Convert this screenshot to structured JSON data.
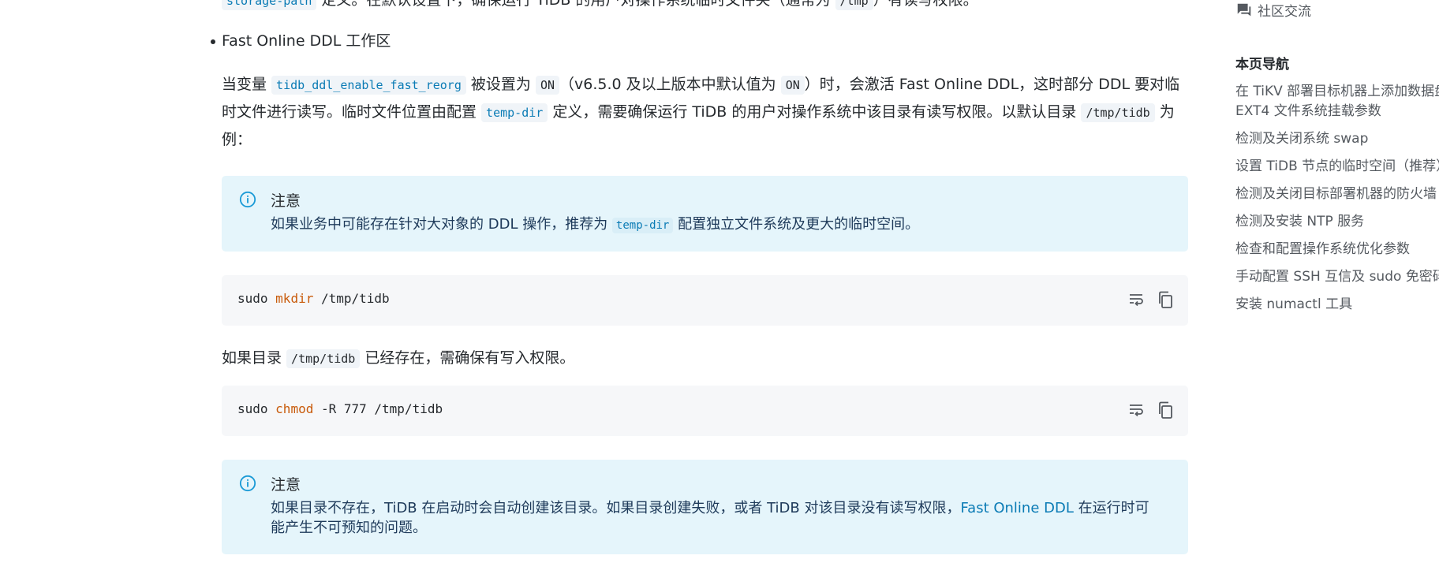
{
  "content": {
    "cut_line": {
      "code1": "storage-path",
      "text": " 定义。在默认设置下，确保运行 TiDB 的用户对操作系统临时文件夹（通常为 ",
      "code2": "/tmp",
      "tail": "）有读写权限。"
    },
    "bullet": "Fast Online DDL 工作区",
    "para": {
      "t1": "当变量 ",
      "c1": "tidb_ddl_enable_fast_reorg",
      "t2": " 被设置为 ",
      "c2": "ON",
      "t3": "（v6.5.0 及以上版本中默认值为 ",
      "c3": "ON",
      "t4": "）时，会激活 Fast Online DDL，这时部分 DDL 要对临时文件进行读写。临时文件位置由配置 ",
      "c4": "temp-dir",
      "t5": " 定义，需要确保运行 TiDB 的用户对操作系统中该目录有读写权限。以默认目录 ",
      "c5": "/tmp/tidb",
      "t6": " 为例："
    },
    "note1": {
      "title": "注意",
      "b1": "如果业务中可能存在针对大对象的 DDL 操作，推荐为 ",
      "code": "temp-dir",
      "b2": " 配置独立文件系统及更大的临时空间。"
    },
    "code1": {
      "cmd": "sudo ",
      "kw": "mkdir",
      "args": " /tmp/tidb"
    },
    "plain": {
      "t1": "如果目录 ",
      "code": "/tmp/tidb",
      "t2": " 已经存在，需确保有写入权限。"
    },
    "code2": {
      "cmd": "sudo ",
      "kw": "chmod",
      "args": " -R 777 /tmp/tidb"
    },
    "note2": {
      "title": "注意",
      "b1": "如果目录不存在，TiDB 在启动时会自动创建该目录。如果目录创建失败，或者 TiDB 对该目录没有读写权限，",
      "link": "Fast Online DDL",
      "b2": " 在运行时可能产生不可预知的问题。"
    }
  },
  "sidebar": {
    "community": "社区交流",
    "nav_title": "本页导航",
    "items": [
      "在 TiKV 部署目标机器上添加数据盘",
      "EXT4 文件系统挂载参数",
      "检测及关闭系统 swap",
      "设置 TiDB 节点的临时空间（推荐）",
      "检测及关闭目标部署机器的防火墙",
      "检测及安装 NTP 服务",
      "检查和配置操作系统优化参数",
      "手动配置 SSH 互信及 sudo 免密码",
      "安装 numactl 工具"
    ]
  },
  "icons": {
    "info": "info-circle-icon",
    "wrap": "wrap-lines-icon",
    "copy": "copy-icon",
    "chat": "chat-bubble-icon"
  },
  "colors": {
    "note_bg": "#e5f5fb",
    "code_bg": "#f6f7f9",
    "link": "#0a7bb5",
    "keyword": "#c85a0a"
  }
}
